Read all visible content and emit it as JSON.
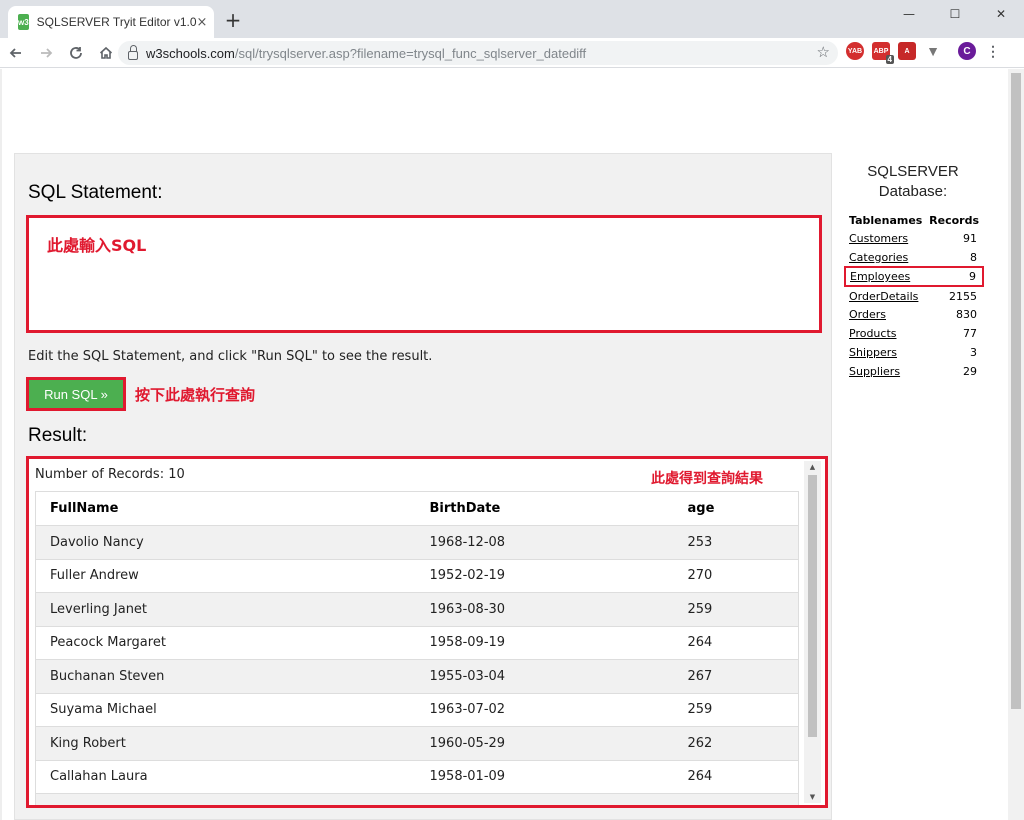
{
  "browser": {
    "tab_title": "SQLSERVER Tryit Editor v1.0",
    "tab_favicon": "w3",
    "tab_close": "×",
    "new_tab": "+",
    "url_host": "w3schools.com",
    "url_path": "/sql/trysqlserver.asp?filename=trysql_func_sqlserver_datediff",
    "extensions": {
      "yab": "YAB",
      "abp": "ABP",
      "abp_badge": "4",
      "pdf": "A",
      "vee": "▼",
      "avatar": "C",
      "menu": "⋮"
    },
    "window_controls": {
      "minimize": "—",
      "maximize": "☐",
      "close": "✕"
    },
    "icons": {
      "back": "arrow-left-icon",
      "forward": "arrow-right-icon",
      "reload": "reload-icon",
      "home": "home-icon",
      "lock": "lock-icon",
      "star": "star-icon"
    }
  },
  "editor": {
    "heading": "SQL Statement:",
    "sql_hint": "此處輸入SQL",
    "instructions": "Edit the SQL Statement, and click \"Run SQL\" to see the result.",
    "run_button": "Run SQL »",
    "run_note": "按下此處執行查詢"
  },
  "result": {
    "heading": "Result:",
    "records_count": "Number of Records: 10",
    "note": "此處得到查詢結果",
    "columns": [
      "FullName",
      "BirthDate",
      "age"
    ],
    "rows": [
      [
        "Davolio Nancy",
        "1968-12-08",
        "253"
      ],
      [
        "Fuller Andrew",
        "1952-02-19",
        "270"
      ],
      [
        "Leverling Janet",
        "1963-08-30",
        "259"
      ],
      [
        "Peacock Margaret",
        "1958-09-19",
        "264"
      ],
      [
        "Buchanan Steven",
        "1955-03-04",
        "267"
      ],
      [
        "Suyama Michael",
        "1963-07-02",
        "259"
      ],
      [
        "King Robert",
        "1960-05-29",
        "262"
      ],
      [
        "Callahan Laura",
        "1958-01-09",
        "264"
      ]
    ]
  },
  "database": {
    "title_line1": "SQLSERVER",
    "title_line2": "Database:",
    "col_tables": "Tablenames",
    "col_records": "Records",
    "tables": [
      {
        "name": "Customers",
        "records": "91"
      },
      {
        "name": "Categories",
        "records": "8"
      },
      {
        "name": "Employees",
        "records": "9"
      },
      {
        "name": "OrderDetails",
        "records": "2155"
      },
      {
        "name": "Orders",
        "records": "830"
      },
      {
        "name": "Products",
        "records": "77"
      },
      {
        "name": "Shippers",
        "records": "3"
      },
      {
        "name": "Suppliers",
        "records": "29"
      }
    ],
    "highlight_color": "#e0192f"
  },
  "colors": {
    "accent_red": "#e0192f",
    "run_green": "#4caf50",
    "panel_gray": "#f1f1f1"
  }
}
